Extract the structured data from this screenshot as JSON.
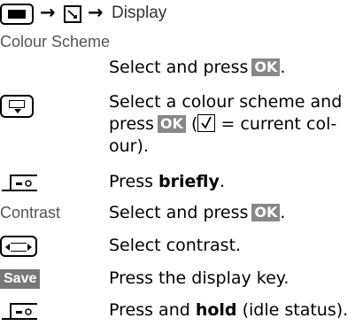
{
  "header": {
    "icons": [
      "menu-key-icon",
      "settings-icon"
    ],
    "separator": "→",
    "destination": "Display"
  },
  "colour_scheme": {
    "heading": "Colour Scheme",
    "step1": {
      "text": "Select and press",
      "key": "OK",
      "end": "."
    },
    "step2": {
      "icon": "up-down-control-key-icon",
      "line1": "Select a colour scheme and",
      "line2_pre": "press",
      "key": "OK",
      "line2_mid": "(",
      "check_meaning": "= current col-",
      "line3": "our)."
    },
    "step3": {
      "icon": "end-call-key-icon",
      "pre": "Press ",
      "bold": "briefly",
      "end": "."
    }
  },
  "contrast": {
    "label": "Contrast",
    "step1": {
      "text": "Select and press",
      "key": "OK",
      "end": "."
    },
    "step2": {
      "icon": "left-right-control-key-icon",
      "text": "Select contrast."
    },
    "step3": {
      "label": "Save",
      "text": "Press the display key."
    },
    "step4": {
      "icon": "end-call-key-icon",
      "pre": "Press and ",
      "bold": "hold",
      "post": " (idle status)."
    }
  }
}
